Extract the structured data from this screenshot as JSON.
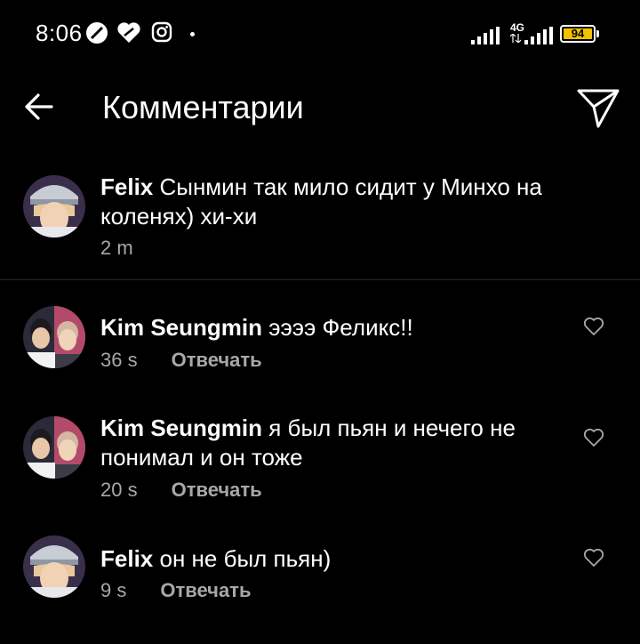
{
  "status_bar": {
    "time": "8:06",
    "network": "4G",
    "battery": "94",
    "icons": [
      "data-saver-icon",
      "heart-status-icon",
      "instagram-icon",
      "more-notifications-dot",
      "wifi-signal-icon",
      "cellular-signal-icon",
      "battery-icon"
    ]
  },
  "header": {
    "title": "Комментарии",
    "back_icon": "arrow-left-icon",
    "share_icon": "paper-plane-icon"
  },
  "caption": {
    "username": "Felix",
    "text": "Сынмин так мило сидит у Минхо на коленях) хи-хи",
    "time": "2 m"
  },
  "comments": [
    {
      "username": "Kim Seungmin",
      "text": "ээээ Феликс!!",
      "time": "36 s",
      "reply_label": "Отвечать"
    },
    {
      "username": "Kim Seungmin",
      "text": "я был пьян и нечего не понимал и он тоже",
      "time": "20 s",
      "reply_label": "Отвечать"
    },
    {
      "username": "Felix",
      "text": "он не был пьян)",
      "time": "9 s",
      "reply_label": "Отвечать"
    }
  ],
  "colors": {
    "background": "#000000",
    "secondary_text": "#a8a8a8",
    "divider": "#262626"
  }
}
